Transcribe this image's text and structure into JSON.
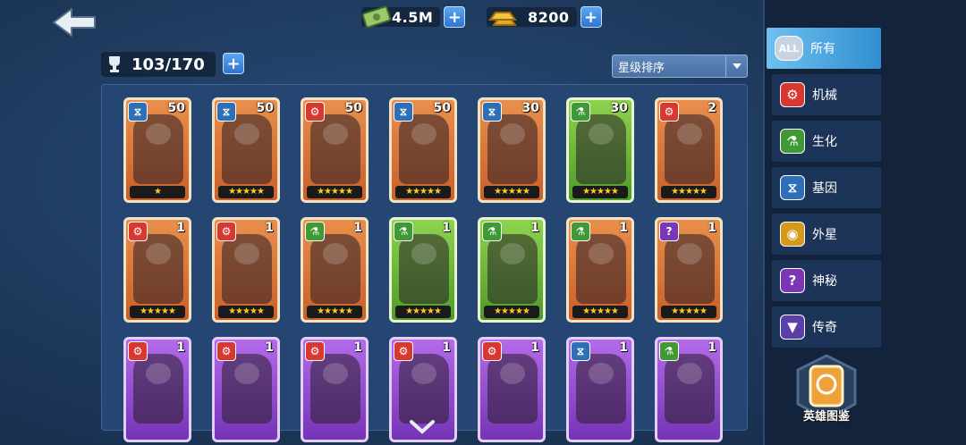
{
  "currency": {
    "cash": "4.5M",
    "gold": "8200"
  },
  "capacity": "103/170",
  "sort": {
    "selected": "星级排序"
  },
  "colors": {
    "orange": "#e98f4d",
    "green": "#8fd34e",
    "purple": "#b36bea",
    "star": "#ffc928",
    "active_tab": "#4fa8e0"
  },
  "heroes": [
    {
      "faction": "gene-icon",
      "level": "50",
      "stars": "★",
      "rarity": "orange"
    },
    {
      "faction": "gene-icon",
      "level": "50",
      "stars": "★★★★★",
      "rarity": "orange"
    },
    {
      "faction": "mech-icon",
      "level": "50",
      "stars": "★★★★★",
      "rarity": "orange"
    },
    {
      "faction": "gene-icon",
      "level": "50",
      "stars": "★★★★★",
      "rarity": "orange"
    },
    {
      "faction": "gene-icon",
      "level": "30",
      "stars": "★★★★★",
      "rarity": "orange"
    },
    {
      "faction": "bio-icon",
      "level": "30",
      "stars": "★★★★★",
      "rarity": "green"
    },
    {
      "faction": "mech-icon",
      "level": "2",
      "stars": "★★★★★",
      "rarity": "orange"
    },
    {
      "faction": "mech-icon",
      "level": "1",
      "stars": "★★★★★",
      "rarity": "orange"
    },
    {
      "faction": "mech-icon",
      "level": "1",
      "stars": "★★★★★",
      "rarity": "orange"
    },
    {
      "faction": "bio-icon",
      "level": "1",
      "stars": "★★★★★",
      "rarity": "orange"
    },
    {
      "faction": "bio-icon",
      "level": "1",
      "stars": "★★★★★",
      "rarity": "green"
    },
    {
      "faction": "bio-icon",
      "level": "1",
      "stars": "★★★★★",
      "rarity": "green"
    },
    {
      "faction": "bio-icon",
      "level": "1",
      "stars": "★★★★★",
      "rarity": "orange"
    },
    {
      "faction": "mystery-icon",
      "level": "1",
      "stars": "★★★★★",
      "rarity": "orange"
    },
    {
      "faction": "mech-icon",
      "level": "1",
      "stars": "",
      "rarity": "purple"
    },
    {
      "faction": "mech-icon",
      "level": "1",
      "stars": "",
      "rarity": "purple"
    },
    {
      "faction": "mech-icon",
      "level": "1",
      "stars": "",
      "rarity": "purple"
    },
    {
      "faction": "mech-icon",
      "level": "1",
      "stars": "",
      "rarity": "purple"
    },
    {
      "faction": "mech-icon",
      "level": "1",
      "stars": "",
      "rarity": "purple"
    },
    {
      "faction": "gene-icon",
      "level": "1",
      "stars": "",
      "rarity": "purple"
    },
    {
      "faction": "bio-icon",
      "level": "1",
      "stars": "",
      "rarity": "purple"
    }
  ],
  "categories": [
    {
      "label": "所有",
      "icon": "all-icon",
      "badge": "ALL",
      "active": true
    },
    {
      "label": "机械",
      "icon": "mech-icon"
    },
    {
      "label": "生化",
      "icon": "bio-icon"
    },
    {
      "label": "基因",
      "icon": "gene-icon"
    },
    {
      "label": "外星",
      "icon": "alien-icon"
    },
    {
      "label": "神秘",
      "icon": "mystery-icon"
    },
    {
      "label": "传奇",
      "icon": "legend-icon"
    }
  ],
  "codex_label": "英雄图鉴"
}
